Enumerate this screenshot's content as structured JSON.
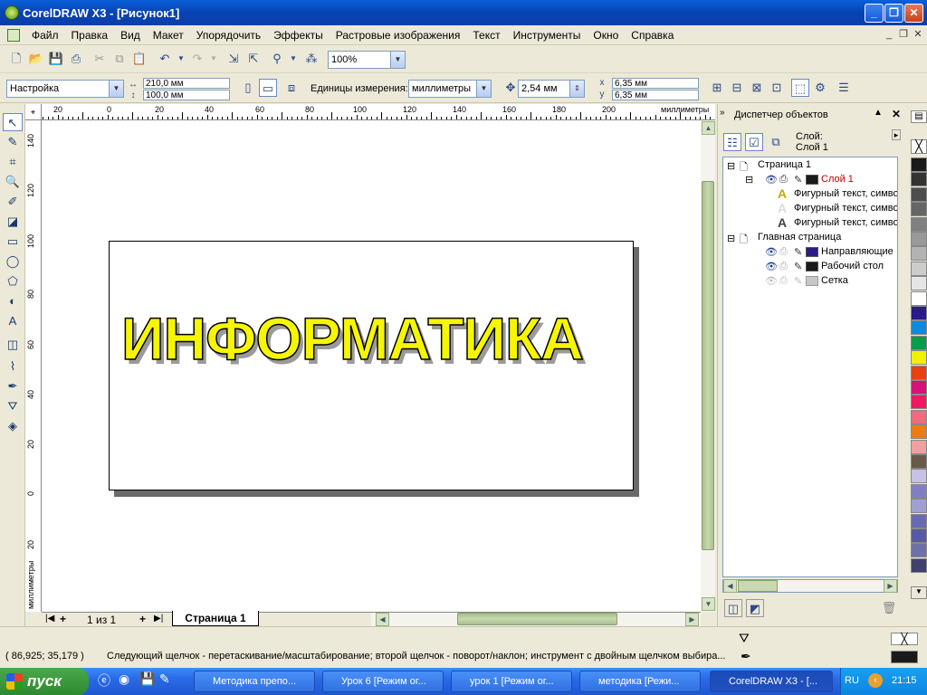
{
  "window": {
    "title": "CorelDRAW X3 - [Рисунок1]"
  },
  "menu": [
    "Файл",
    "Правка",
    "Вид",
    "Макет",
    "Упорядочить",
    "Эффекты",
    "Растровые изображения",
    "Текст",
    "Инструменты",
    "Окно",
    "Справка"
  ],
  "toolbar": {
    "zoom": "100%"
  },
  "property_bar": {
    "preset": "Настройка",
    "width": "210,0 мм",
    "height": "100,0 мм",
    "units_label": "Единицы измерения:",
    "units": "миллиметры",
    "nudge": "2,54 мм",
    "dup_x": "6,35 мм",
    "dup_y": "6,35 мм"
  },
  "ruler": {
    "h_labels": [
      "20",
      "0",
      "20",
      "40",
      "60",
      "80",
      "100",
      "120",
      "140",
      "160",
      "180",
      "200"
    ],
    "h_unit": "миллиметры",
    "v_labels": [
      "140",
      "120",
      "100",
      "80",
      "60",
      "40",
      "20",
      "0",
      "20"
    ],
    "v_unit": "миллиметры"
  },
  "canvas": {
    "artistic_text": "ИНФОРМАТИКА"
  },
  "pages": {
    "counter": "1 из 1",
    "tab": "Страница 1"
  },
  "docker": {
    "title": "Диспетчер объектов",
    "layer_label": "Слой:",
    "layer_value": "Слой 1",
    "tree": {
      "page1": "Страница 1",
      "layer1": "Слой 1",
      "obj1": "Фигурный текст, симво",
      "obj2": "Фигурный текст, симво",
      "obj3": "Фигурный текст, симво",
      "master": "Главная страница",
      "guides": "Направляющие",
      "desktop": "Рабочий стол",
      "grid": "Сетка"
    }
  },
  "palette_colors": [
    "#1a1a1a",
    "#333333",
    "#4d4d4d",
    "#666666",
    "#808080",
    "#999999",
    "#b3b3b3",
    "#cccccc",
    "#e6e6e6",
    "#ffffff",
    "#2a1a8a",
    "#0a8ae0",
    "#0a9a4a",
    "#f0f000",
    "#e84010",
    "#d8107a",
    "#f01860",
    "#f06a80",
    "#f07a10",
    "#f0a0a0",
    "#6a5a4a",
    "#c8c0e8",
    "#8080c0",
    "#a0a0d0",
    "#6a6ab0",
    "#5a5aa0",
    "#7070a8",
    "#404070"
  ],
  "status": {
    "coords": "( 86,925; 35,179 )",
    "hint": "Следующий щелчок - перетаскивание/масштабирование; второй щелчок - поворот/наклон; инструмент с двойным щелчком выбира..."
  },
  "taskbar": {
    "start": "пуск",
    "tasks": [
      "Методика препо...",
      "Урок 6 [Режим ог...",
      "урок 1 [Режим ог...",
      "методика [Режи...",
      "CorelDRAW X3 - [..."
    ],
    "lang": "RU",
    "clock": "21:15"
  }
}
